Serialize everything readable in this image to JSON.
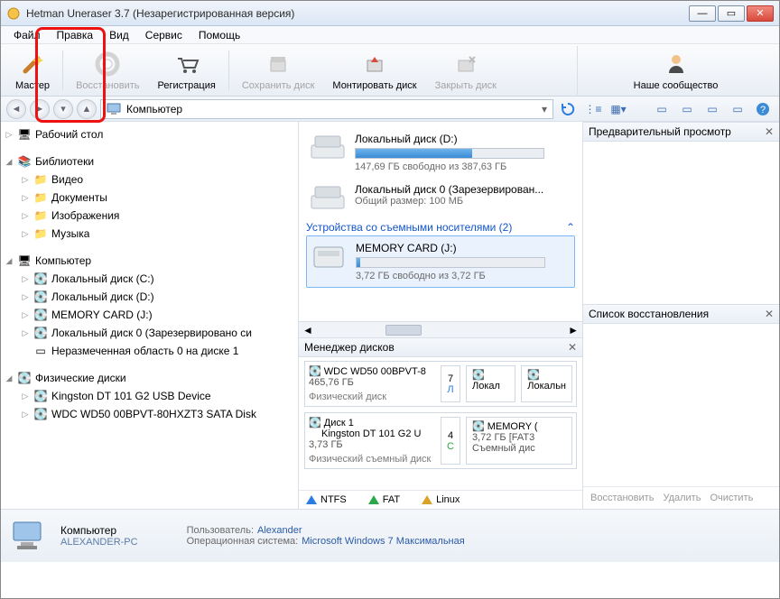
{
  "titlebar": {
    "text": "Hetman Uneraser 3.7 (Незарегистрированная версия)"
  },
  "menu": {
    "file": "Файл",
    "edit": "Правка",
    "view": "Вид",
    "service": "Сервис",
    "help": "Помощь"
  },
  "toolbar": {
    "wizard": "Мастер",
    "restore": "Восстановить",
    "register": "Регистрация",
    "savedisk": "Сохранить диск",
    "mount": "Монтировать диск",
    "closedisk": "Закрыть диск",
    "community": "Наше сообщество"
  },
  "address": "Компьютер",
  "tree": {
    "desktop": "Рабочий стол",
    "libraries": "Библиотеки",
    "lib": {
      "video": "Видео",
      "documents": "Документы",
      "images": "Изображения",
      "music": "Музыка"
    },
    "computer": "Компьютер",
    "comp": {
      "c": "Локальный диск (C:)",
      "d": "Локальный диск (D:)",
      "j": "MEMORY CARD (J:)",
      "r": "Локальный диск 0 (Зарезервировано си",
      "u": "Неразмеченная область 0 на диске 1"
    },
    "phys": "Физические диски",
    "physd": {
      "kingston": "Kingston DT 101 G2 USB Device",
      "wdc": "WDC WD50 00BPVT-80HXZT3 SATA Disk"
    }
  },
  "drives": {
    "d": {
      "title": "Локальный диск (D:)",
      "sub": "147,69 ГБ свободно из 387,63 ГБ"
    },
    "r": {
      "title": "Локальный диск 0 (Зарезервирован...",
      "sub": "Общий размер: 100 МБ"
    },
    "section": "Устройства со съемными носителями (2)",
    "j": {
      "title": "MEMORY CARD (J:)",
      "sub": "3,72 ГБ свободно из 3,72 ГБ"
    }
  },
  "preview": {
    "title": "Предварительный просмотр"
  },
  "diskmgr": {
    "title": "Менеджер дисков",
    "disk0": {
      "name": "WDC WD50 00BPVT-8",
      "size": "465,76 ГБ",
      "type": "Физический диск",
      "p1": "Локал",
      "p2": "Локальн"
    },
    "disk1": {
      "name": "Диск 1",
      "name2": "Kingston DT 101 G2 U",
      "size": "3,73 ГБ",
      "type": "Физический съемный диск",
      "p1": "MEMORY (",
      "p1s": "3,72 ГБ [FAT3",
      "p1t": "Съемный дис"
    },
    "legend": {
      "ntfs": "NTFS",
      "fat": "FAT",
      "linux": "Linux"
    }
  },
  "recovery": {
    "title": "Список восстановления",
    "restore": "Восстановить",
    "del": "Удалить",
    "clear": "Очистить"
  },
  "status": {
    "computer": "Компьютер",
    "pc": "ALEXANDER-PC",
    "user_l": "Пользователь:",
    "user_v": "Alexander",
    "os_l": "Операционная система:",
    "os_v": "Microsoft Windows 7 Максимальная"
  },
  "chart_data": null
}
